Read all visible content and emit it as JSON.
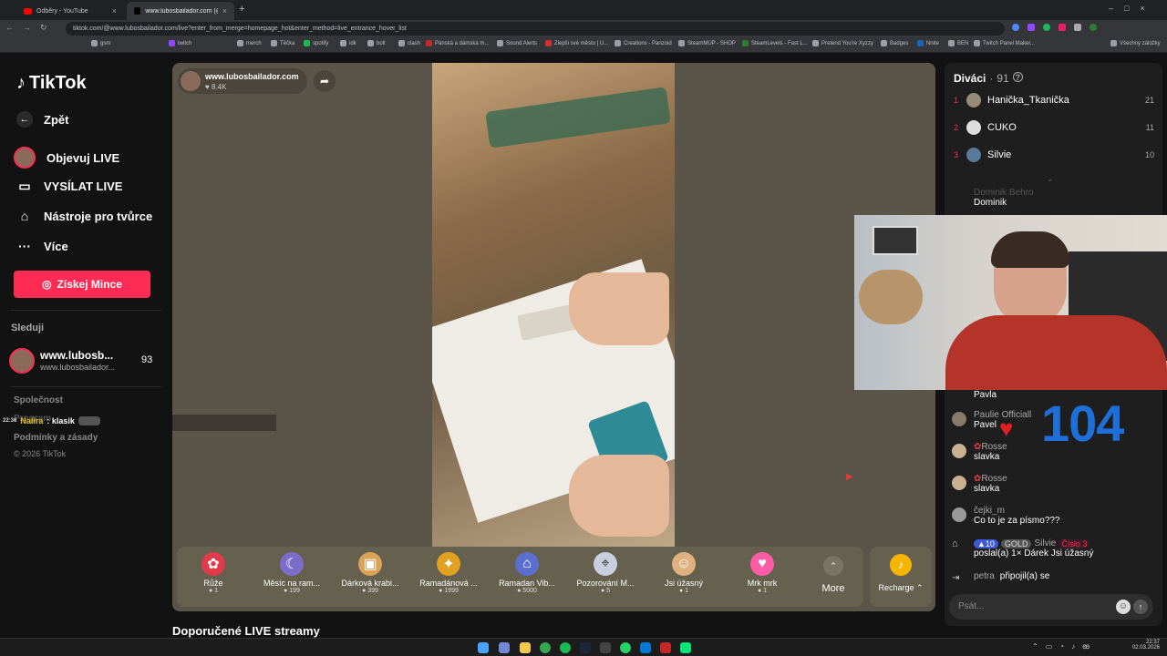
{
  "browser": {
    "tabs": [
      {
        "label": "Odběry - YouTube"
      },
      {
        "label": "www.lubosbailador.com (@..."
      }
    ],
    "url": "tiktok.com/@www.lubosbailador.com/live?enter_from_merge=homepage_hot&enter_method=live_entrance_hover_list",
    "bookmarks": [
      "gsm",
      "twitch",
      "merch",
      "Těčka",
      "spotify",
      "idk",
      "bolt",
      "clash",
      "Pánská a dámská m...",
      "Sound Alerts",
      "Zlepši své město | U...",
      "Creations - Panzoid",
      "SteamMUP - SHOP",
      "SteamLevels - Fast L...",
      "Pretend You're Xyzzy",
      "Badges",
      "Nnite",
      "BEN",
      "Twitch Panel Maker...",
      "Všechny záložky"
    ]
  },
  "sidebar": {
    "logo": "TikTok",
    "back": "Zpět",
    "nav": [
      {
        "label": "Objevuj LIVE",
        "icon": "live-avatar-icon"
      },
      {
        "label": "VYSÍLAT LIVE",
        "icon": "camera-icon"
      },
      {
        "label": "Nástroje pro tvůrce",
        "icon": "house-icon"
      },
      {
        "label": "Více",
        "icon": "more-icon"
      }
    ],
    "coins_button": "Získej Mince",
    "following_title": "Sleduji",
    "following": {
      "name": "www.lubosb...",
      "handle": "www.lubosbailador...",
      "count": "93"
    },
    "company": "Společnost",
    "program": "Program",
    "terms": "Podmínky a zásady",
    "copyright": "© 2026 TikTok"
  },
  "overlay_chat": {
    "time": "22:36",
    "user": "Nalira",
    "text": ": klasik"
  },
  "stream": {
    "host_name": "www.lubosbailador.com",
    "host_likes": "8.4K",
    "gifts": [
      {
        "name": "Růže",
        "price": "1",
        "icon": "rose-icon",
        "color": "#e23a4a"
      },
      {
        "name": "Měsíc na ram...",
        "price": "199",
        "icon": "moon-icon",
        "color": "#7a6cc8"
      },
      {
        "name": "Dárková krabi...",
        "price": "399",
        "icon": "giftbox-icon",
        "color": "#d9a35a"
      },
      {
        "name": "Ramadánová ...",
        "price": "1999",
        "icon": "lantern-icon",
        "color": "#e0a020"
      },
      {
        "name": "Ramadan Vib...",
        "price": "5000",
        "icon": "mosque-icon",
        "color": "#5b6fd0"
      },
      {
        "name": "Pozorování M...",
        "price": "5",
        "icon": "telescope-icon",
        "color": "#c8d0e0"
      },
      {
        "name": "Jsi úžasný",
        "price": "1",
        "icon": "cat-icon",
        "color": "#e0b080"
      },
      {
        "name": "Mrk mrk",
        "price": "1",
        "icon": "heart-icon",
        "color": "#ff5ca8"
      }
    ],
    "more": "More",
    "recharge": "Recharge",
    "recommended": "Doporučené LIVE streamy"
  },
  "chat": {
    "viewers_title": "Diváci",
    "viewers_count": "91",
    "top_viewers": [
      {
        "rank": "1",
        "name": "Hanička_Tkanička",
        "score": "21"
      },
      {
        "rank": "2",
        "name": "CUKO",
        "score": "11"
      },
      {
        "rank": "3",
        "name": "Silvie",
        "score": "10"
      }
    ],
    "messages": [
      {
        "name": "Dominik Behro",
        "text": "Dominik"
      },
      {
        "name": "",
        "text": "Pavla"
      },
      {
        "name": "Paulie Officiall",
        "text": "Pavel"
      },
      {
        "name": "Rosse",
        "text": "slavka"
      },
      {
        "name": "Rosse",
        "text": "slavka"
      },
      {
        "name": "čejki_m",
        "text": "Co to je za písmo???"
      }
    ],
    "gift_msg": {
      "level": "10",
      "tier": "GOLD",
      "name": "Silvie",
      "badge": "Číslo 3",
      "text": "poslal(a) 1× Dárek Jsi úžasný"
    },
    "join_msg": {
      "name": "petra",
      "text": "připojil(a) se"
    },
    "input_placeholder": "Psát..."
  },
  "overlay_counter": "104",
  "taskbar": {
    "time": "22:37",
    "date": "02.03.2026"
  }
}
